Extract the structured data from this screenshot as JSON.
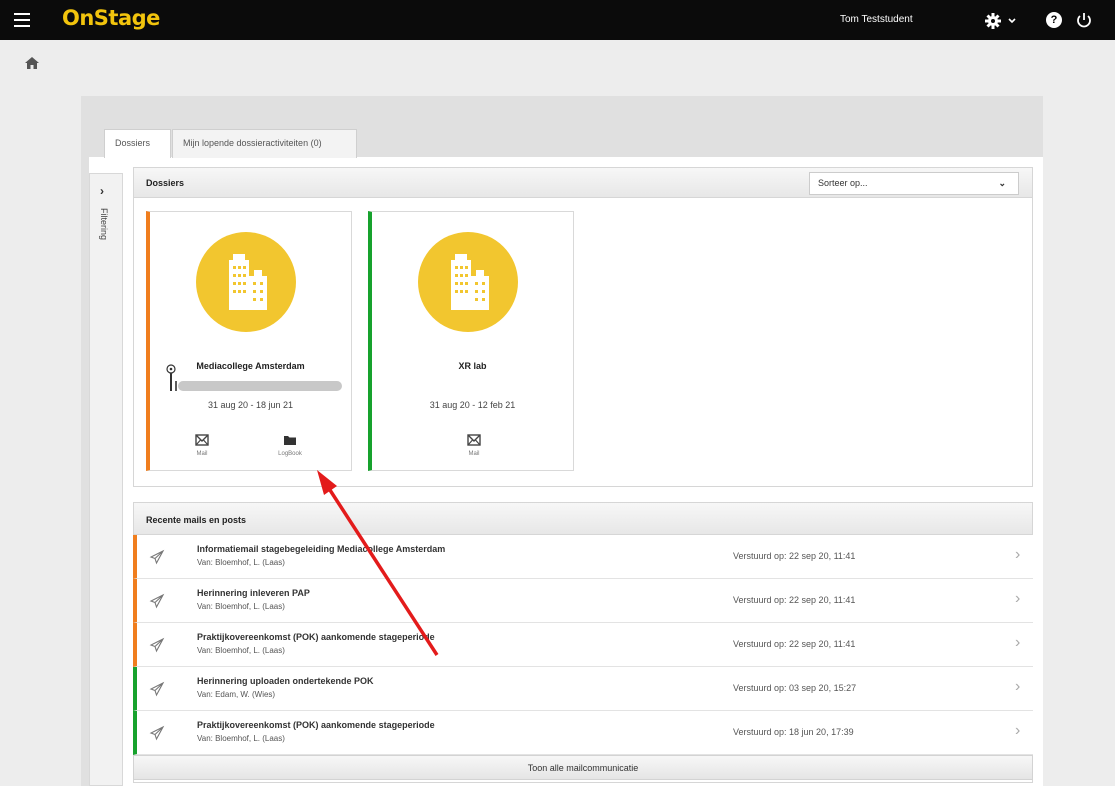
{
  "header": {
    "logo": "OnStage",
    "user": "Tom Teststudent",
    "help_symbol": "?"
  },
  "tabs": [
    {
      "label": "Dossiers"
    },
    {
      "label": "Mijn lopende dossieractiviteiten (0)"
    }
  ],
  "filter": {
    "label": "Filtering"
  },
  "dossiers": {
    "title": "Dossiers",
    "sort_value": "Sorteer op...",
    "cards": [
      {
        "name": "Mediacollege Amsterdam",
        "dates": "31 aug 20 - 18 jun 21",
        "accent": "#f07e1e",
        "progress": 0.05,
        "actions": [
          {
            "label": "Mail",
            "icon": "envelope-icon"
          },
          {
            "label": "LogBook",
            "icon": "folder-icon"
          }
        ]
      },
      {
        "name": "XR lab",
        "dates": "31 aug 20 - 12 feb 21",
        "accent": "#17a22d",
        "actions": [
          {
            "label": "Mail",
            "icon": "envelope-icon"
          }
        ]
      }
    ]
  },
  "mails": {
    "title": "Recente mails en posts",
    "rows": [
      {
        "subject": "Informatiemail stagebegeleiding Mediacollege Amsterdam",
        "from": "Van: Bloemhof, L. (Laas)",
        "date": "Verstuurd op: 22 sep 20, 11:41",
        "accent": "orange"
      },
      {
        "subject": "Herinnering inleveren PAP",
        "from": "Van: Bloemhof, L. (Laas)",
        "date": "Verstuurd op: 22 sep 20, 11:41",
        "accent": "orange"
      },
      {
        "subject": "Praktijkovereenkomst (POK) aankomende stageperiode",
        "from": "Van: Bloemhof, L. (Laas)",
        "date": "Verstuurd op: 22 sep 20, 11:41",
        "accent": "orange"
      },
      {
        "subject": "Herinnering uploaden ondertekende POK",
        "from": "Van: Edam, W. (Wies)",
        "date": "Verstuurd op: 03 sep 20, 15:27",
        "accent": "green"
      },
      {
        "subject": "Praktijkovereenkomst (POK) aankomende stageperiode",
        "from": "Van: Bloemhof, L. (Laas)",
        "date": "Verstuurd op: 18 jun 20, 17:39",
        "accent": "green"
      }
    ],
    "show_all": "Toon alle mailcommunicatie"
  },
  "colors": {
    "brand": "#f2c40d",
    "orange": "#f07e1e",
    "green": "#17a22d",
    "annotation_arrow": "#e31b1b"
  }
}
